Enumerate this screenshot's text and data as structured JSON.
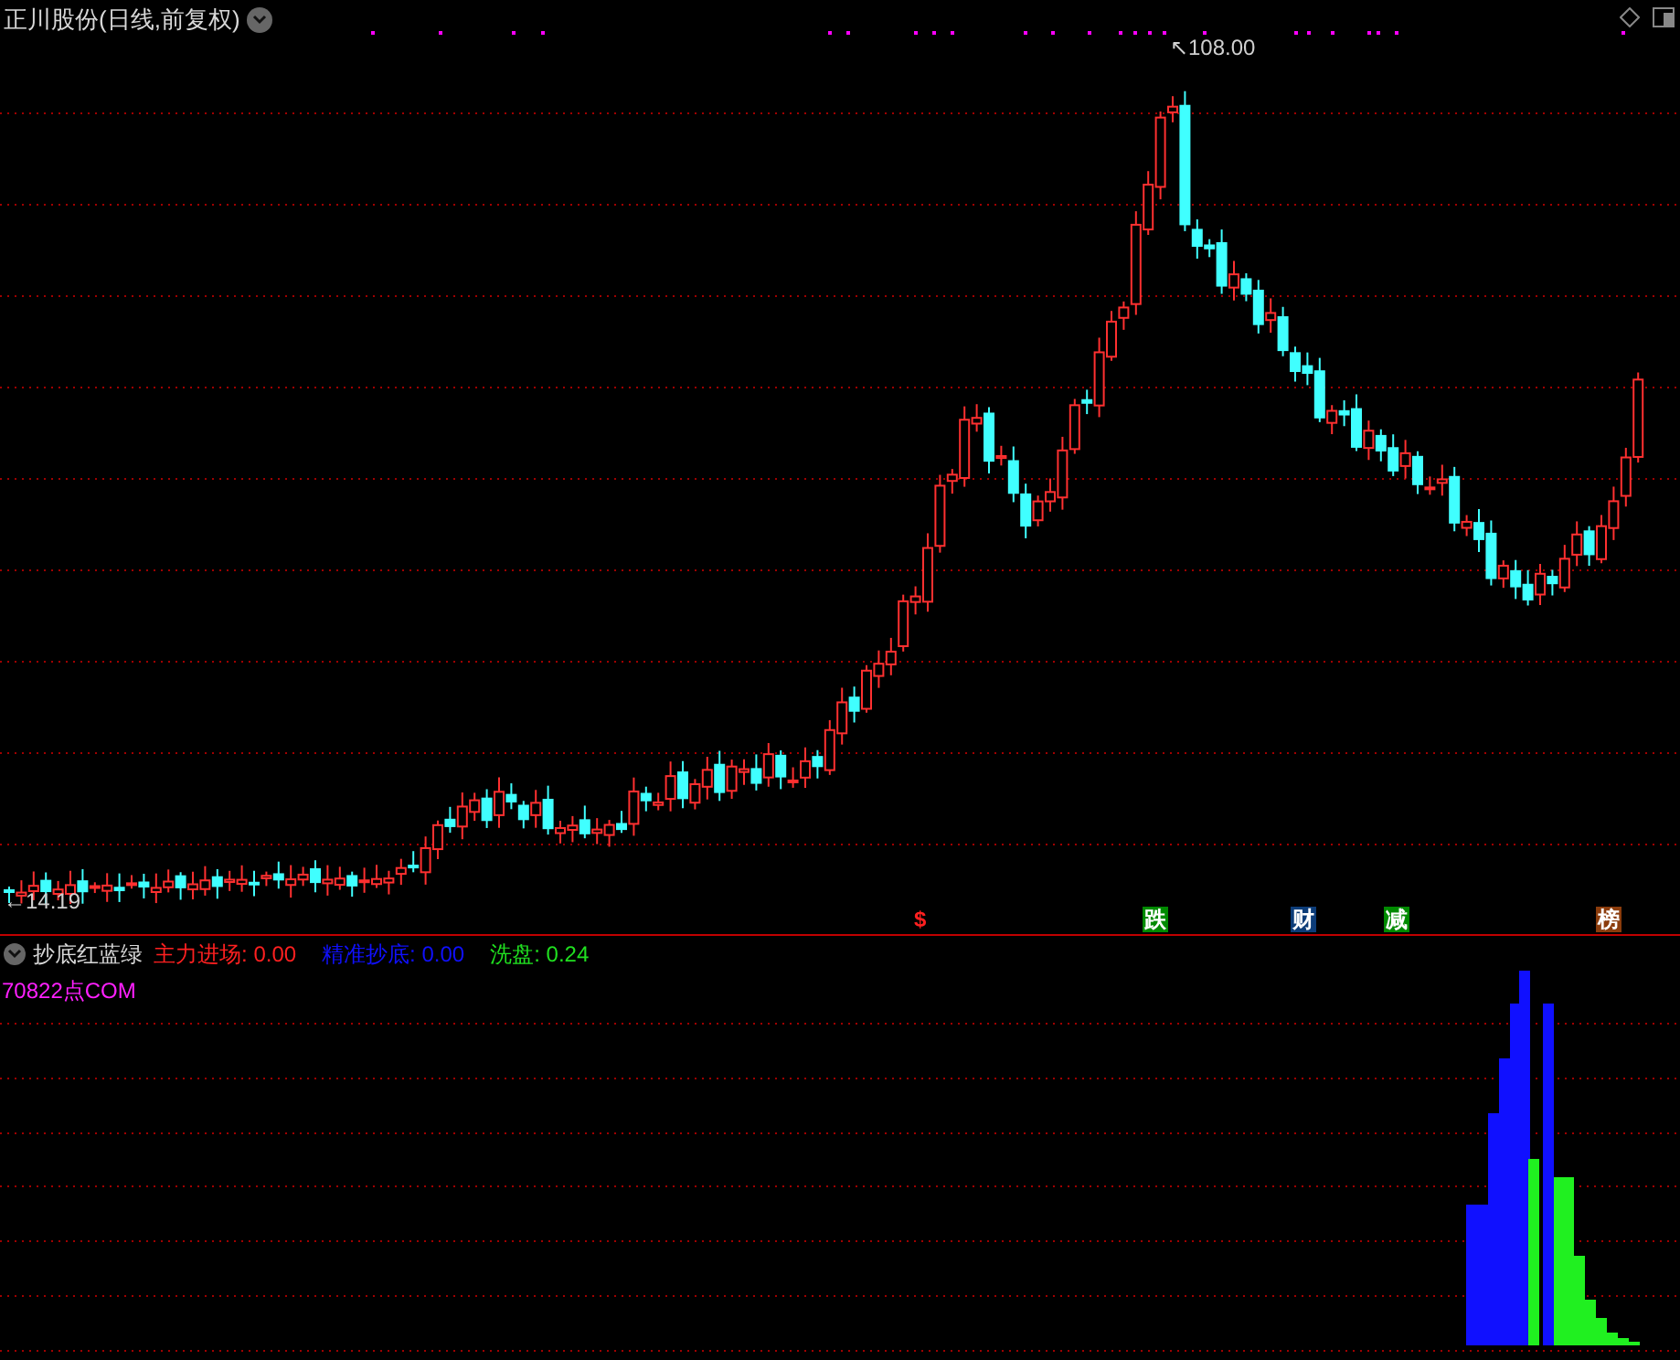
{
  "main_chart": {
    "title": "正川股份(日线,前复权)",
    "high_label": "↖108.00",
    "low_label": "←14.19",
    "markers": [
      {
        "label": "$",
        "kind": "plain",
        "color": "#ff2020"
      },
      {
        "label": "跌",
        "kind": "boxed",
        "color": "#008a00"
      },
      {
        "label": "财",
        "kind": "boxed",
        "color": "#0c3c78"
      },
      {
        "label": "减",
        "kind": "boxed",
        "color": "#008a00"
      },
      {
        "label": "榜",
        "kind": "boxed",
        "color": "#8b3c0c"
      }
    ]
  },
  "indicator": {
    "name": "抄底红蓝绿",
    "watermark": "70822点COM",
    "legend": [
      {
        "label": "主力进场:",
        "value": "0.00",
        "color": "#ff2020"
      },
      {
        "label": "精准抄底:",
        "value": "0.00",
        "color": "#1010ff"
      },
      {
        "label": "洗盘:",
        "value": "0.24",
        "color": "#20e020"
      }
    ]
  }
}
